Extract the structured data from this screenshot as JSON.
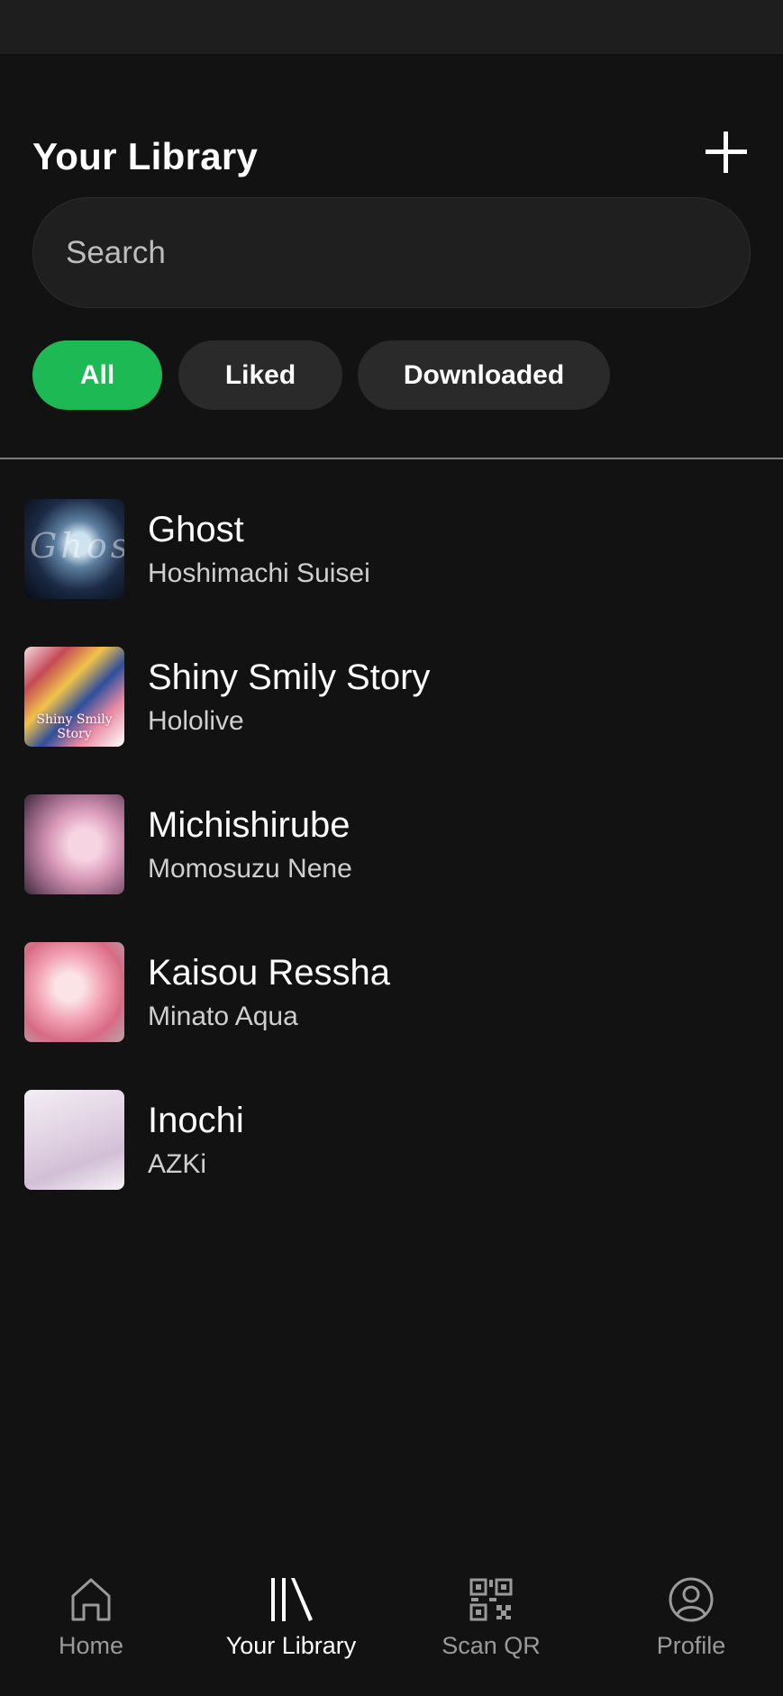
{
  "header": {
    "title": "Your Library",
    "add_icon": "plus-icon"
  },
  "search": {
    "placeholder": "Search",
    "value": ""
  },
  "filters": [
    {
      "label": "All",
      "selected": true
    },
    {
      "label": "Liked",
      "selected": false
    },
    {
      "label": "Downloaded",
      "selected": false
    }
  ],
  "tracks": [
    {
      "title": "Ghost",
      "artist": "Hoshimachi Suisei",
      "cover_text": "Ghost"
    },
    {
      "title": "Shiny Smily Story",
      "artist": "Hololive",
      "cover_text": "Shiny Smily Story"
    },
    {
      "title": "Michishirube",
      "artist": "Momosuzu Nene",
      "cover_text": ""
    },
    {
      "title": "Kaisou Ressha",
      "artist": "Minato Aqua",
      "cover_text": ""
    },
    {
      "title": "Inochi",
      "artist": "AZKi",
      "cover_text": ""
    }
  ],
  "nav": [
    {
      "label": "Home",
      "icon": "home-icon",
      "active": false
    },
    {
      "label": "Your Library",
      "icon": "library-icon",
      "active": true
    },
    {
      "label": "Scan QR",
      "icon": "qr-code-icon",
      "active": false
    },
    {
      "label": "Profile",
      "icon": "profile-icon",
      "active": false
    }
  ],
  "colors": {
    "background": "#121212",
    "accent": "#1db954",
    "chip_inactive": "#2a2a2a",
    "nav_inactive": "#9a9a9a"
  }
}
